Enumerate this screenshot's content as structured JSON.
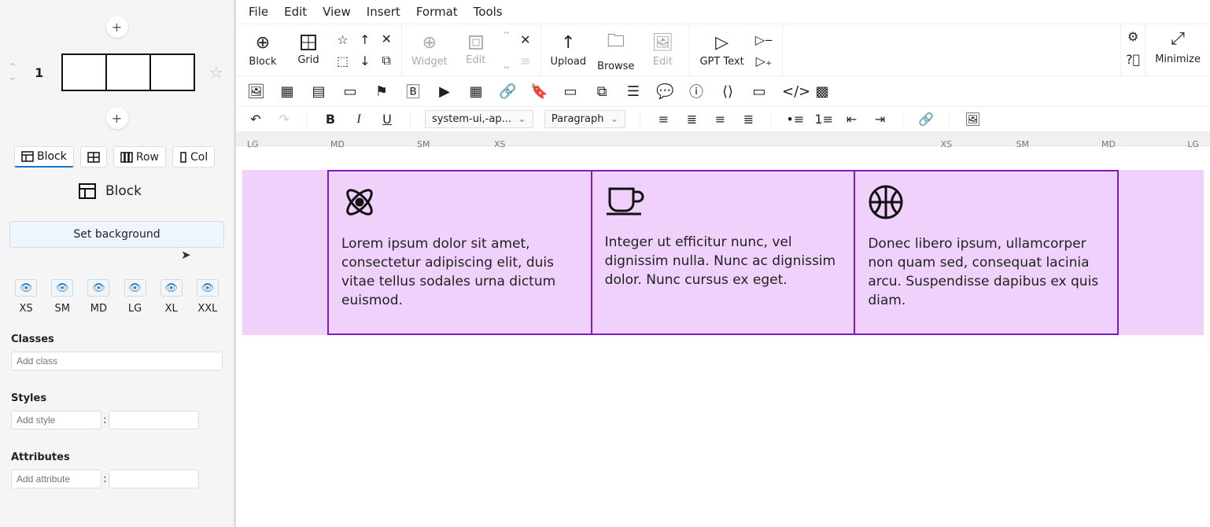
{
  "sidebar": {
    "row_number": "1",
    "tabs": [
      {
        "label": "Block"
      },
      {
        "label": ""
      },
      {
        "label": "Row"
      },
      {
        "label": "Col"
      }
    ],
    "block_label": "Block",
    "set_background": "Set background",
    "visibilities": [
      "XS",
      "SM",
      "MD",
      "LG",
      "XL",
      "XXL"
    ],
    "sections": {
      "classes": "Classes",
      "styles": "Styles",
      "attributes": "Attributes"
    },
    "placeholders": {
      "add_class": "Add class",
      "add_style": "Add style",
      "add_attr": "Add attribute"
    }
  },
  "menu": [
    "File",
    "Edit",
    "View",
    "Insert",
    "Format",
    "Tools"
  ],
  "toolbar1": {
    "block": "Block",
    "grid": "Grid",
    "widget": "Widget",
    "edit": "Edit",
    "upload": "Upload",
    "browse": "Browse",
    "edit2": "Edit",
    "gpt": "GPT Text",
    "minimize": "Minimize"
  },
  "dropdowns": {
    "font": "system-ui,-ap...",
    "para": "Paragraph"
  },
  "ruler": [
    "LG",
    "MD",
    "SM",
    "XS",
    "XS",
    "SM",
    "MD",
    "LG"
  ],
  "columns": [
    {
      "text": "Lorem ipsum dolor sit amet, consectetur adipiscing elit, duis vitae tellus sodales urna dictum euismod."
    },
    {
      "text": "Integer ut efficitur nunc, vel dignissim nulla. Nunc ac dignissim dolor. Nunc cursus ex eget."
    },
    {
      "text": "Donec libero ipsum, ullamcorper non quam sed, consequat lacinia arcu. Suspendisse dapibus ex quis diam."
    }
  ]
}
